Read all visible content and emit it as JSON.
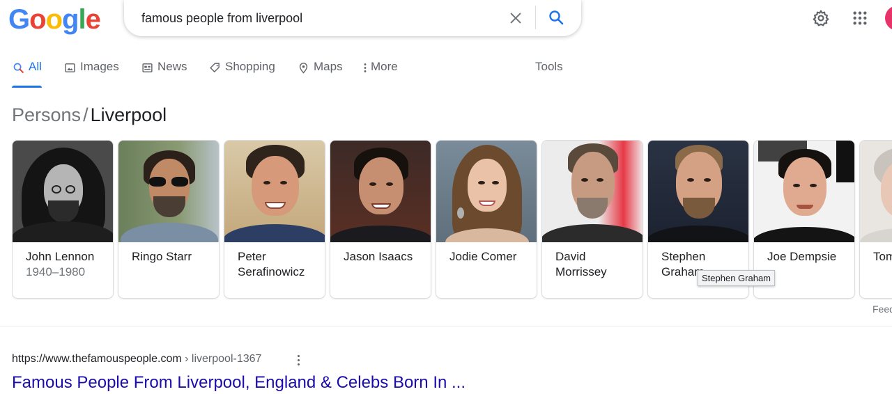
{
  "header": {
    "logo": {
      "letters": [
        "G",
        "o",
        "o",
        "g",
        "l",
        "e"
      ],
      "colors": [
        "#4285f4",
        "#ea4335",
        "#fbbc05",
        "#4285f4",
        "#34a853",
        "#ea4335"
      ]
    },
    "search": {
      "query": "famous people from liverpool"
    },
    "icons": {
      "clear": "close-icon",
      "search": "magnifier-icon",
      "settings": "gear-icon",
      "apps": "grid-icon"
    },
    "avatar_color": "#e8336a"
  },
  "tabs": [
    {
      "label": "All",
      "icon": "search-icon",
      "active": true
    },
    {
      "label": "Images",
      "icon": "image-icon",
      "active": false
    },
    {
      "label": "News",
      "icon": "news-icon",
      "active": false
    },
    {
      "label": "Shopping",
      "icon": "tag-icon",
      "active": false
    },
    {
      "label": "Maps",
      "icon": "pin-icon",
      "active": false
    },
    {
      "label": "More",
      "icon": "more-vert-icon",
      "active": false
    }
  ],
  "tools_label": "Tools",
  "heading": {
    "crumb1": "Persons",
    "separator": "/",
    "crumb2": "Liverpool"
  },
  "people": [
    {
      "name": "John Lennon",
      "sub": "1940–1980",
      "photo_bw": true
    },
    {
      "name": "Ringo Starr",
      "sub": ""
    },
    {
      "name": "Peter Serafinowicz",
      "sub": ""
    },
    {
      "name": "Jason Isaacs",
      "sub": ""
    },
    {
      "name": "Jodie Comer",
      "sub": ""
    },
    {
      "name": "David Morrissey",
      "sub": ""
    },
    {
      "name": "Stephen Graham",
      "sub": ""
    },
    {
      "name": "Joe Dempsie",
      "sub": ""
    },
    {
      "name": "Tom",
      "sub": ""
    }
  ],
  "tooltip": "Stephen Graham",
  "feedback_label": "Feed",
  "result": {
    "url_base": "https://www.thefamouspeople.com",
    "url_path": " › liverpool-1367",
    "title": "Famous People From Liverpool, England & Celebs Born In ..."
  },
  "colors": {
    "link": "#1a0dab",
    "accent": "#1a73e8"
  }
}
